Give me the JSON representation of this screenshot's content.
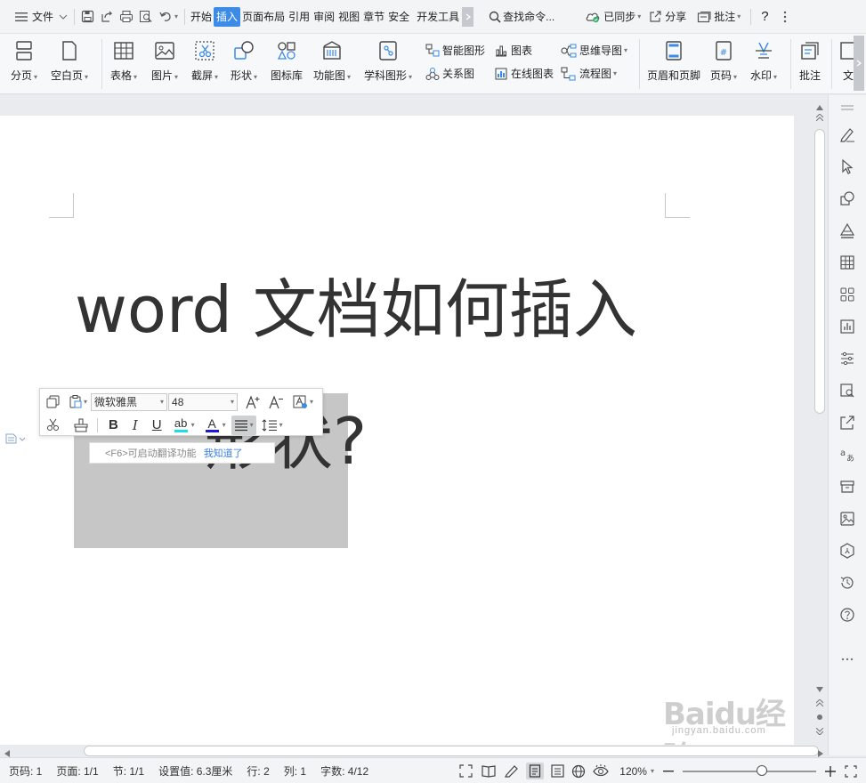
{
  "menubar": {
    "file_label": "文件",
    "tabs": [
      "开始",
      "插入",
      "页面布局",
      "引用",
      "审阅",
      "视图",
      "章节",
      "安全",
      "开发工具"
    ],
    "active_tab": "插入",
    "search_label": "查找命令...",
    "sync_label": "已同步",
    "share_label": "分享",
    "comment_label": "批注",
    "help_label": "?"
  },
  "ribbon": {
    "page_break": "分页",
    "blank_page": "空白页",
    "table": "表格",
    "picture": "图片",
    "screenshot": "截屏",
    "shape": "形状",
    "icon_lib": "图标库",
    "func_chart": "功能图",
    "subject_chart": "学科图形",
    "smart_art": "智能图形",
    "chart": "图表",
    "mind_map": "思维导图",
    "relation": "关系图",
    "online_chart": "在线图表",
    "flow_chart": "流程图",
    "header_footer": "页眉和页脚",
    "page_num": "页码",
    "watermark": "水印",
    "comment": "批注",
    "text": "文"
  },
  "document": {
    "line1": "word 文档如何插入",
    "line2": "形状?"
  },
  "format_toolbar": {
    "font_name": "微软雅黑",
    "font_size": "48",
    "bold": "B",
    "italic": "I",
    "underline": "U",
    "highlight": "ab",
    "font_color": "A"
  },
  "tip": {
    "text": "<F6>可启动翻译功能",
    "link": "我知道了"
  },
  "statusbar": {
    "page_num": "页码: 1",
    "pages": "页面: 1/1",
    "section": "节: 1/1",
    "setting": "设置值: 6.3厘米",
    "row": "行: 2",
    "col": "列: 1",
    "words": "字数: 4/12",
    "zoom": "120%",
    "zoom_level": 0.59
  },
  "watermark": {
    "main": "Baidu经验",
    "sub": "jingyan.baidu.com"
  },
  "colors": {
    "accent": "#3c8be6",
    "selection": "#c6c6c6",
    "link": "#3a7fd6"
  }
}
